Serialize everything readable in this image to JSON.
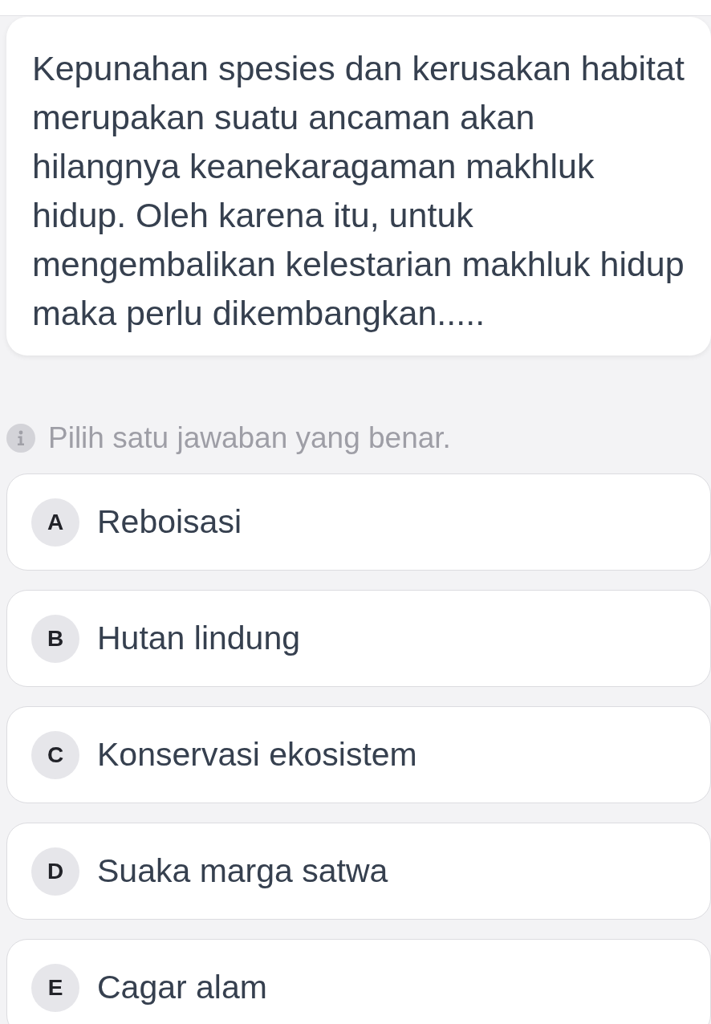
{
  "question": {
    "text": "Kepunahan spesies dan kerusakan habitat merupakan suatu ancaman akan hilangnya keanekaragaman makhluk hidup. Oleh karena itu, untuk mengembalikan kelestarian makhluk hidup maka perlu dikembangkan....."
  },
  "instruction": {
    "text": "Pilih satu jawaban yang benar."
  },
  "options": [
    {
      "letter": "A",
      "text": "Reboisasi",
      "selected": false
    },
    {
      "letter": "B",
      "text": "Hutan lindung",
      "selected": false
    },
    {
      "letter": "C",
      "text": "Konservasi ekosistem",
      "selected": false
    },
    {
      "letter": "D",
      "text": "Suaka marga satwa",
      "selected": false
    },
    {
      "letter": "E",
      "text": "Cagar alam",
      "selected": false
    }
  ]
}
